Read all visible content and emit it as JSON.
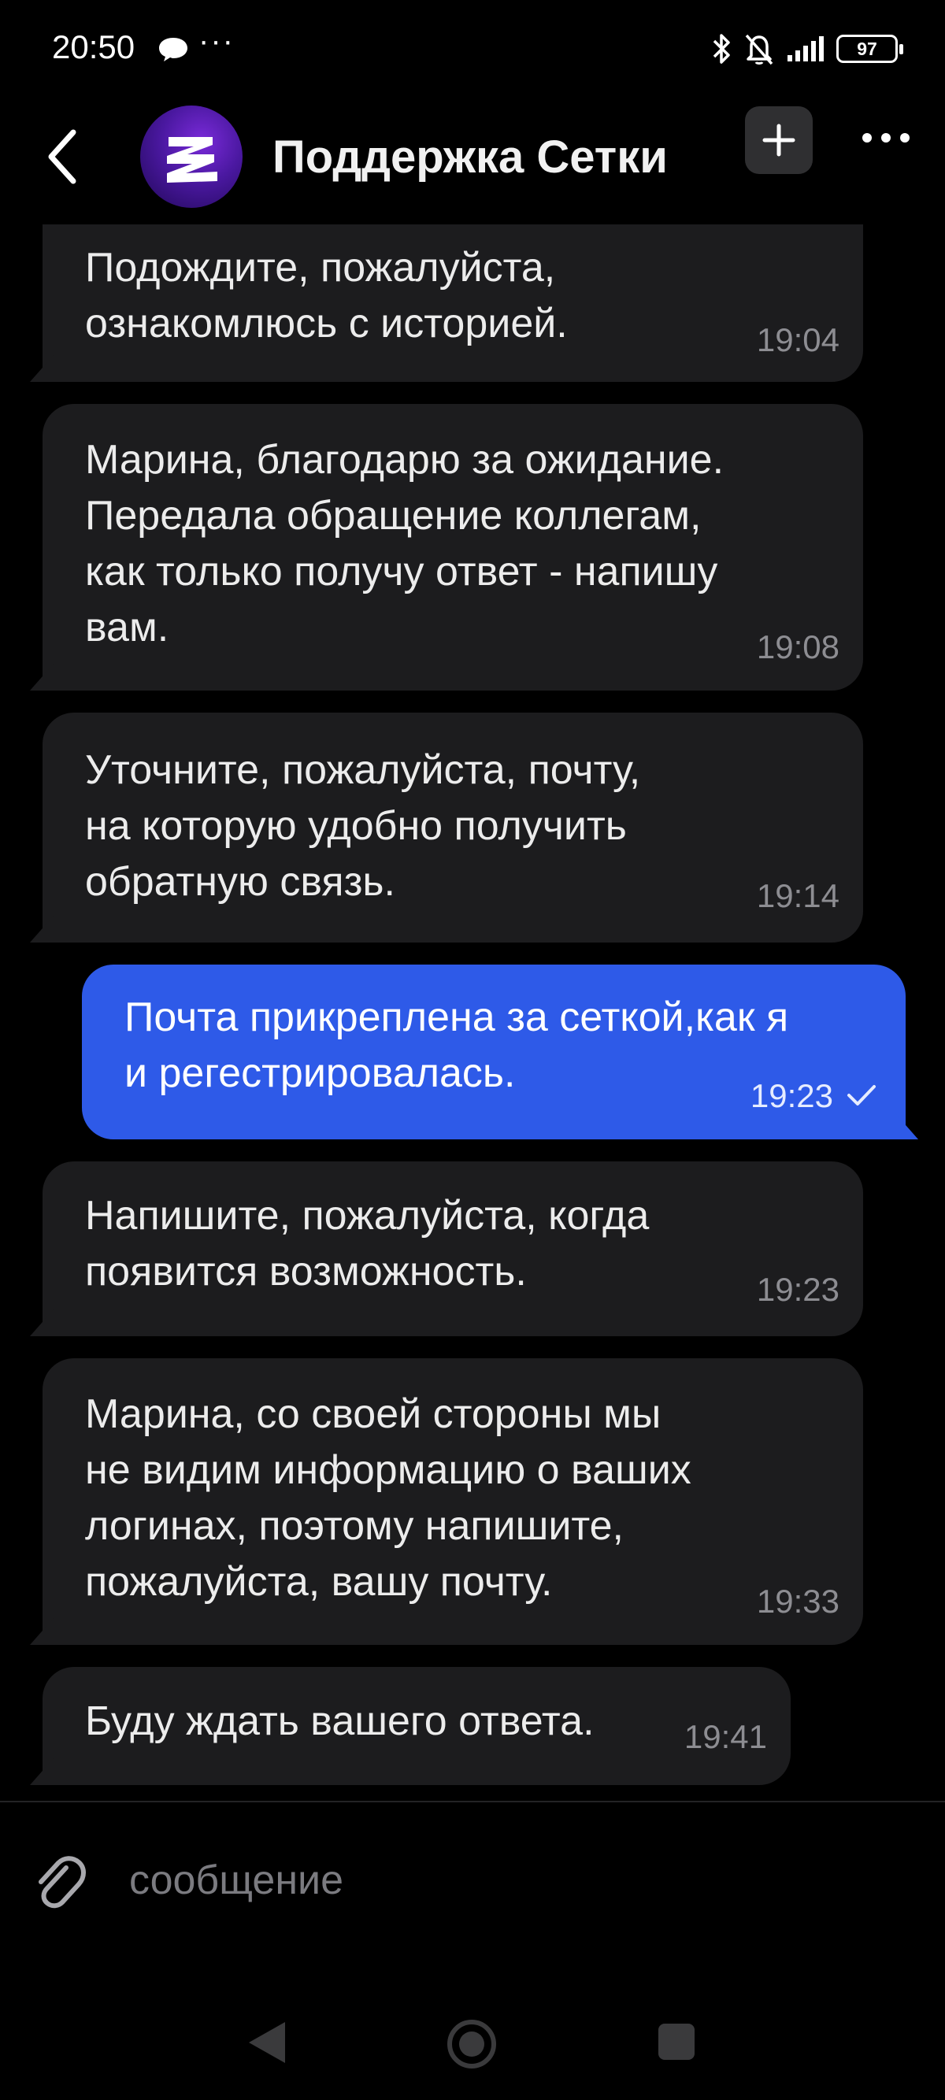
{
  "status_bar": {
    "time": "20:50",
    "more": "···",
    "battery": "97"
  },
  "header": {
    "title": "Поддержка Сетки",
    "avatar_color": "#5a1fc0"
  },
  "messages": [
    {
      "direction": "incoming",
      "text": "Подождите, пожалуйста,\nознакомлюсь с историей.",
      "time": "19:04"
    },
    {
      "direction": "incoming",
      "text": "Марина, благодарю за ожидание.\nПередала обращение коллегам,\nкак только получу ответ - напишу\nвам.",
      "time": "19:08"
    },
    {
      "direction": "incoming",
      "text": "Уточните, пожалуйста, почту,\nна которую удобно получить\nобратную связь.",
      "time": "19:14"
    },
    {
      "direction": "outgoing",
      "text": "Почта прикреплена за сеткой,как я\nи регестрировалась.",
      "time": "19:23",
      "read": true
    },
    {
      "direction": "incoming",
      "text": "Напишите, пожалуйста, когда\nпоявится возможность.",
      "time": "19:23"
    },
    {
      "direction": "incoming",
      "text": "Марина, со своей стороны мы\nне видим информацию о ваших\nлогинах, поэтому напишите,\nпожалуйста, вашу почту.",
      "time": "19:33"
    },
    {
      "direction": "incoming",
      "text": "Буду ждать вашего ответа.",
      "time": "19:41"
    }
  ],
  "composer": {
    "placeholder": "сообщение"
  },
  "colors": {
    "background": "#000000",
    "incoming_bubble": "#1c1c1e",
    "outgoing_bubble": "#2e5ae8",
    "time_gray": "#8d8d92"
  }
}
